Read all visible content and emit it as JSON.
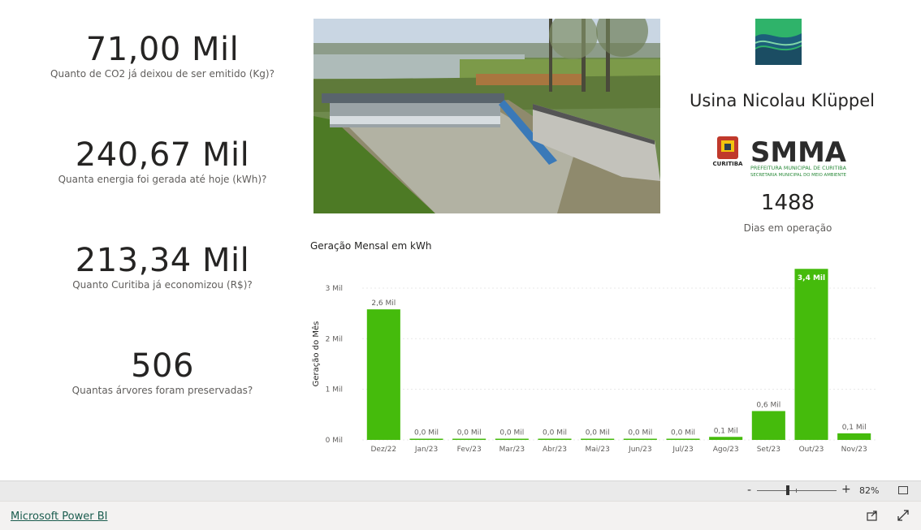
{
  "kpis": [
    {
      "value": "71,00 Mil",
      "label": "Quanto de CO2 já deixou de ser emitido (Kg)?"
    },
    {
      "value": "240,67 Mil",
      "label": "Quanta energia foi gerada até hoje (kWh)?"
    },
    {
      "value": "213,34 Mil",
      "label": "Quanto Curitiba já economizou (R$)?"
    },
    {
      "value": "506",
      "label": "Quantas árvores foram preservadas?"
    }
  ],
  "site": {
    "title": "Usina Nicolau Klüppel",
    "days_value": "1488",
    "days_label": "Dias em operação",
    "photo_icon": "hydro-plant-photo",
    "logo_icon": "green-wave-logo"
  },
  "smma_logo": {
    "name": "SMMA",
    "sub1": "PREFEITURA MUNICIPAL DE CURITIBA",
    "sub2": "SECRETARIA MUNICIPAL DO MEIO AMBIENTE",
    "city": "CURITIBA"
  },
  "chart_data": {
    "type": "bar",
    "title": "Geração Mensal em kWh",
    "ylabel": "Geração do Mês",
    "xlabel": "",
    "categories": [
      "Dez/22",
      "Jan/23",
      "Fev/23",
      "Mar/23",
      "Abr/23",
      "Mai/23",
      "Jun/23",
      "Jul/23",
      "Ago/23",
      "Set/23",
      "Out/23",
      "Nov/23"
    ],
    "values": [
      2580,
      10,
      0,
      0,
      10,
      10,
      10,
      10,
      60,
      570,
      3380,
      130
    ],
    "data_labels": [
      "2,6 Mil",
      "0,0 Mil",
      "0,0 Mil",
      "0,0 Mil",
      "0,0 Mil",
      "0,0 Mil",
      "0,0 Mil",
      "0,0 Mil",
      "0,1 Mil",
      "0,6 Mil",
      "3,4 Mil",
      "0,1 Mil"
    ],
    "yticks": [
      0,
      1000,
      2000,
      3000
    ],
    "ytick_labels": [
      "0 Mil",
      "1 Mil",
      "2 Mil",
      "3 Mil"
    ],
    "ylim": [
      0,
      3400
    ],
    "grid": true,
    "bar_color": "#45bb0c"
  },
  "zoom": {
    "minus": "-",
    "plus": "+",
    "percent": "82%"
  },
  "footer": {
    "link": "Microsoft Power BI"
  }
}
